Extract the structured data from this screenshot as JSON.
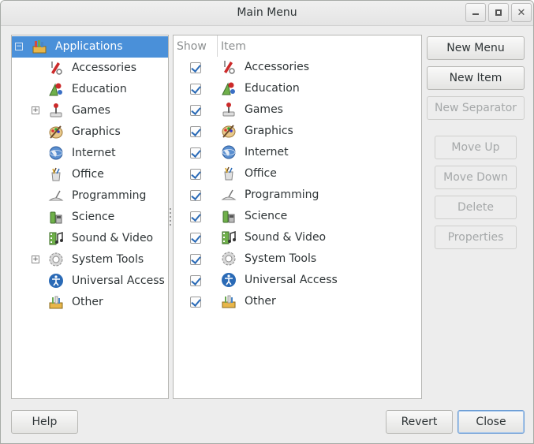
{
  "window": {
    "title": "Main Menu",
    "controls": [
      "minimize-icon",
      "maximize-icon",
      "close-icon"
    ]
  },
  "tree": {
    "root": {
      "label": "Applications",
      "icon": "applications-icon",
      "expanded": true,
      "selected": true
    },
    "items": [
      {
        "label": "Accessories",
        "icon": "accessories-icon",
        "expandable": false
      },
      {
        "label": "Education",
        "icon": "education-icon",
        "expandable": false
      },
      {
        "label": "Games",
        "icon": "games-icon",
        "expandable": true
      },
      {
        "label": "Graphics",
        "icon": "graphics-icon",
        "expandable": false
      },
      {
        "label": "Internet",
        "icon": "internet-icon",
        "expandable": false
      },
      {
        "label": "Office",
        "icon": "office-icon",
        "expandable": false
      },
      {
        "label": "Programming",
        "icon": "programming-icon",
        "expandable": false
      },
      {
        "label": "Science",
        "icon": "science-icon",
        "expandable": false
      },
      {
        "label": "Sound & Video",
        "icon": "sound-video-icon",
        "expandable": false
      },
      {
        "label": "System Tools",
        "icon": "system-tools-icon",
        "expandable": true
      },
      {
        "label": "Universal Access",
        "icon": "universal-access-icon",
        "expandable": false
      },
      {
        "label": "Other",
        "icon": "other-icon",
        "expandable": false
      }
    ]
  },
  "list": {
    "columns": {
      "show": "Show",
      "item": "Item"
    },
    "rows": [
      {
        "label": "Accessories",
        "icon": "accessories-icon",
        "show": true
      },
      {
        "label": "Education",
        "icon": "education-icon",
        "show": true
      },
      {
        "label": "Games",
        "icon": "games-icon",
        "show": true
      },
      {
        "label": "Graphics",
        "icon": "graphics-icon",
        "show": true
      },
      {
        "label": "Internet",
        "icon": "internet-icon",
        "show": true
      },
      {
        "label": "Office",
        "icon": "office-icon",
        "show": true
      },
      {
        "label": "Programming",
        "icon": "programming-icon",
        "show": true
      },
      {
        "label": "Science",
        "icon": "science-icon",
        "show": true
      },
      {
        "label": "Sound & Video",
        "icon": "sound-video-icon",
        "show": true
      },
      {
        "label": "System Tools",
        "icon": "system-tools-icon",
        "show": true
      },
      {
        "label": "Universal Access",
        "icon": "universal-access-icon",
        "show": true
      },
      {
        "label": "Other",
        "icon": "other-icon",
        "show": true
      }
    ]
  },
  "actions": {
    "new_menu": "New Menu",
    "new_item": "New Item",
    "new_separator": "New Separator",
    "move_up": "Move Up",
    "move_down": "Move Down",
    "delete": "Delete",
    "properties": "Properties"
  },
  "footer": {
    "help": "Help",
    "revert": "Revert",
    "close": "Close"
  },
  "colors": {
    "selection": "#4a90d9",
    "check": "#2a6ab6",
    "window_bg": "#ededed"
  }
}
